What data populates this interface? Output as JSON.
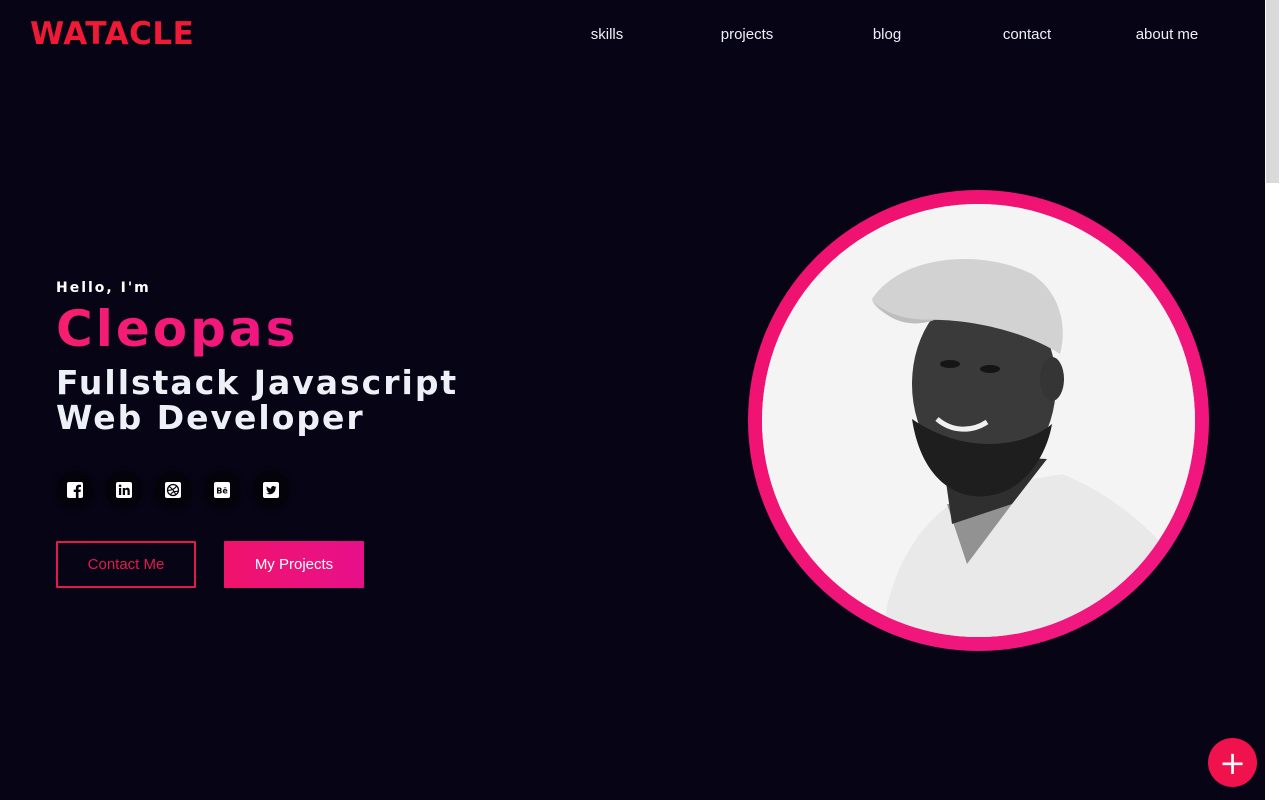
{
  "brand": {
    "logo_text": "WATACLE",
    "accent": "#f01a36"
  },
  "nav": {
    "items": [
      {
        "label": "skills"
      },
      {
        "label": "projects"
      },
      {
        "label": "blog"
      },
      {
        "label": "contact"
      },
      {
        "label": "about me"
      }
    ]
  },
  "hero": {
    "greeting": "Hello, I'm",
    "name": "Cleopas",
    "role": "Fullstack Javascript Web Developer",
    "name_color": "#f01a6e"
  },
  "socials": [
    {
      "icon": "facebook-icon"
    },
    {
      "icon": "linkedin-icon"
    },
    {
      "icon": "dribbble-icon"
    },
    {
      "icon": "behance-icon"
    },
    {
      "icon": "twitter-icon"
    }
  ],
  "buttons": {
    "contact_label": "Contact Me",
    "projects_label": "My Projects"
  },
  "profile": {
    "alt": "portrait photo"
  },
  "fab": {
    "label": "+"
  }
}
